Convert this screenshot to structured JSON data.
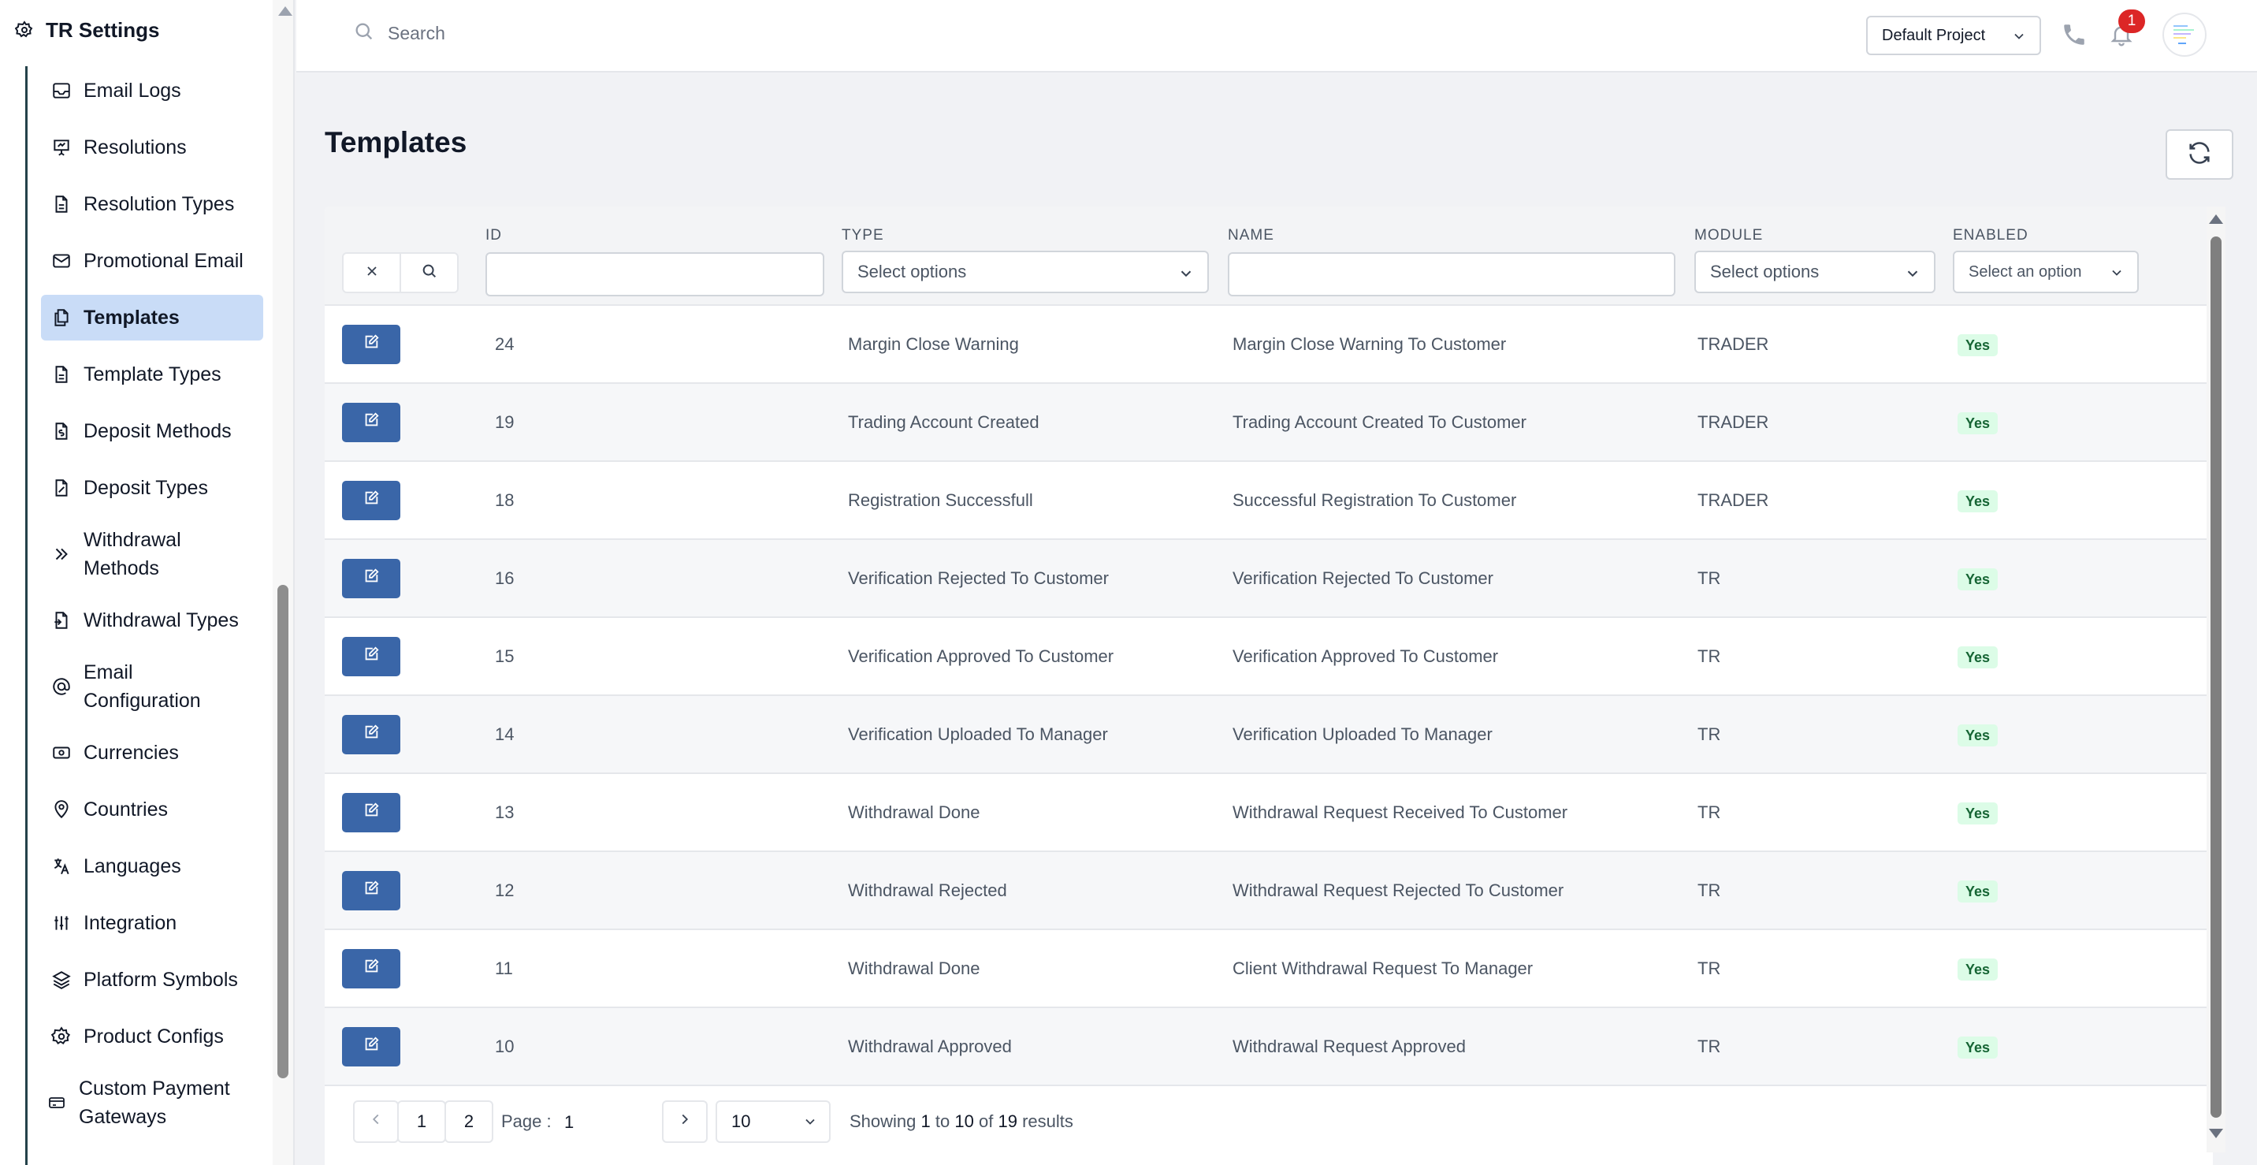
{
  "sidebar": {
    "title": "TR Settings",
    "items": [
      {
        "label": "Email Logs",
        "icon": "inbox-icon"
      },
      {
        "label": "Resolutions",
        "icon": "presentation-icon"
      },
      {
        "label": "Resolution Types",
        "icon": "document-icon"
      },
      {
        "label": "Promotional Email",
        "icon": "mail-icon"
      },
      {
        "label": "Templates",
        "icon": "copy-icon",
        "active": true
      },
      {
        "label": "Template Types",
        "icon": "document-icon"
      },
      {
        "label": "Deposit Methods",
        "icon": "file-dollar-icon"
      },
      {
        "label": "Deposit Types",
        "icon": "file-percent-icon"
      },
      {
        "label": "Withdrawal Methods",
        "icon": "chevrons-right-icon"
      },
      {
        "label": "Withdrawal Types",
        "icon": "file-export-icon"
      },
      {
        "label": "Email Configuration",
        "icon": "at-icon"
      },
      {
        "label": "Currencies",
        "icon": "cash-icon"
      },
      {
        "label": "Countries",
        "icon": "map-pin-icon"
      },
      {
        "label": "Languages",
        "icon": "translate-icon"
      },
      {
        "label": "Integration",
        "icon": "sliders-icon"
      },
      {
        "label": "Platform Symbols",
        "icon": "layers-icon"
      },
      {
        "label": "Product Configs",
        "icon": "settings-icon"
      },
      {
        "label": "Custom Payment Gateways",
        "icon": "credit-card-icon"
      }
    ]
  },
  "topbar": {
    "search_placeholder": "Search",
    "project": "Default Project",
    "notification_count": "1"
  },
  "page": {
    "title": "Templates"
  },
  "table": {
    "columns": {
      "id": "ID",
      "type": "TYPE",
      "name": "NAME",
      "module": "MODULE",
      "enabled": "ENABLED"
    },
    "filters": {
      "type_placeholder": "Select options",
      "module_placeholder": "Select options",
      "enabled_placeholder": "Select an option"
    },
    "rows": [
      {
        "id": "24",
        "type": "Margin Close Warning",
        "name": "Margin Close Warning To Customer",
        "module": "TRADER",
        "enabled": "Yes"
      },
      {
        "id": "19",
        "type": "Trading Account Created",
        "name": "Trading Account Created To Customer",
        "module": "TRADER",
        "enabled": "Yes"
      },
      {
        "id": "18",
        "type": "Registration Successfull",
        "name": "Successful Registration To Customer",
        "module": "TRADER",
        "enabled": "Yes"
      },
      {
        "id": "16",
        "type": "Verification Rejected To Customer",
        "name": "Verification Rejected To Customer",
        "module": "TR",
        "enabled": "Yes"
      },
      {
        "id": "15",
        "type": "Verification Approved To Customer",
        "name": "Verification Approved To Customer",
        "module": "TR",
        "enabled": "Yes"
      },
      {
        "id": "14",
        "type": "Verification Uploaded To Manager",
        "name": "Verification Uploaded To Manager",
        "module": "TR",
        "enabled": "Yes"
      },
      {
        "id": "13",
        "type": "Withdrawal Done",
        "name": "Withdrawal Request Received To Customer",
        "module": "TR",
        "enabled": "Yes"
      },
      {
        "id": "12",
        "type": "Withdrawal Rejected",
        "name": "Withdrawal Request Rejected To Customer",
        "module": "TR",
        "enabled": "Yes"
      },
      {
        "id": "11",
        "type": "Withdrawal Done",
        "name": "Client Withdrawal Request To Manager",
        "module": "TR",
        "enabled": "Yes"
      },
      {
        "id": "10",
        "type": "Withdrawal Approved",
        "name": "Withdrawal Request Approved",
        "module": "TR",
        "enabled": "Yes"
      }
    ]
  },
  "pagination": {
    "pages": [
      "1",
      "2"
    ],
    "page_label": "Page :",
    "current_page": "1",
    "page_size": "10",
    "showing_prefix": "Showing",
    "from": "1",
    "to_word": "to",
    "to": "10",
    "of_word": "of",
    "total": "19",
    "results_word": "results"
  },
  "colors": {
    "accent": "#3a66a8",
    "active_item_bg": "#c9dcf7",
    "badge_bg": "#dcfce7",
    "badge_text": "#166534",
    "notification": "#dc2626"
  }
}
